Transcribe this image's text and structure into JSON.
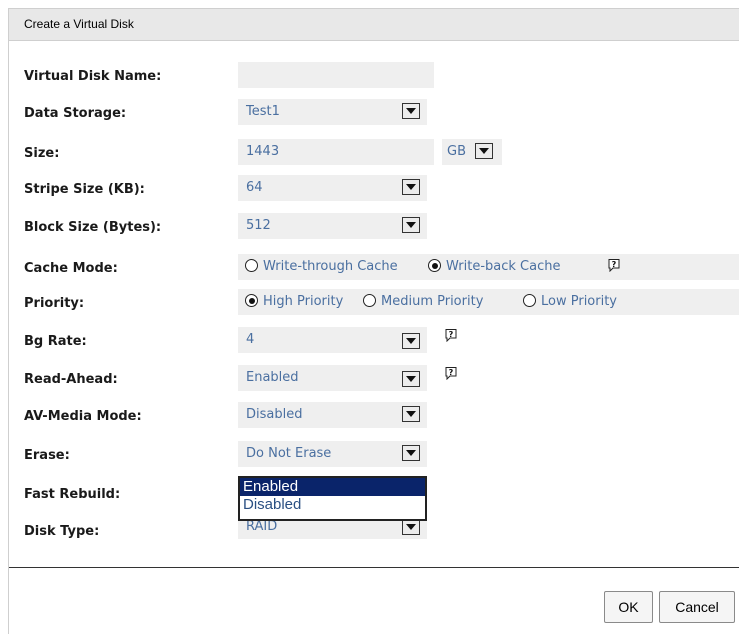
{
  "dialog": {
    "title": "Create a Virtual Disk",
    "fields": {
      "virtual_disk_name": {
        "label": "Virtual Disk Name:",
        "value": ""
      },
      "data_storage": {
        "label": "Data Storage:",
        "value": "Test1"
      },
      "size": {
        "label": "Size:",
        "value": "1443",
        "unit": "GB"
      },
      "stripe_size": {
        "label": "Stripe Size (KB):",
        "value": "64"
      },
      "block_size": {
        "label": "Block Size (Bytes):",
        "value": "512"
      },
      "cache_mode": {
        "label": "Cache Mode:",
        "options": [
          "Write-through Cache",
          "Write-back Cache"
        ],
        "selected": "Write-back Cache"
      },
      "priority": {
        "label": "Priority:",
        "options": [
          "High Priority",
          "Medium Priority",
          "Low Priority"
        ],
        "selected": "High Priority"
      },
      "bg_rate": {
        "label": "Bg Rate:",
        "value": "4"
      },
      "read_ahead": {
        "label": "Read-Ahead:",
        "value": "Enabled"
      },
      "av_media_mode": {
        "label": "AV-Media Mode:",
        "value": "Disabled"
      },
      "erase": {
        "label": "Erase:",
        "value": "Do Not Erase"
      },
      "fast_rebuild": {
        "label": "Fast Rebuild:",
        "dropdown_options": [
          "Enabled",
          "Disabled"
        ],
        "highlighted": "Enabled"
      },
      "disk_type": {
        "label": "Disk Type:",
        "value": "RAID"
      }
    },
    "buttons": {
      "ok": "OK",
      "cancel": "Cancel"
    }
  },
  "icons": {
    "dropdown_arrow": "chevron-down-icon",
    "help": "help-icon"
  },
  "colors": {
    "field_bg": "#efefef",
    "field_text": "#4a6fa0",
    "popup_highlight": "#0a246a"
  }
}
